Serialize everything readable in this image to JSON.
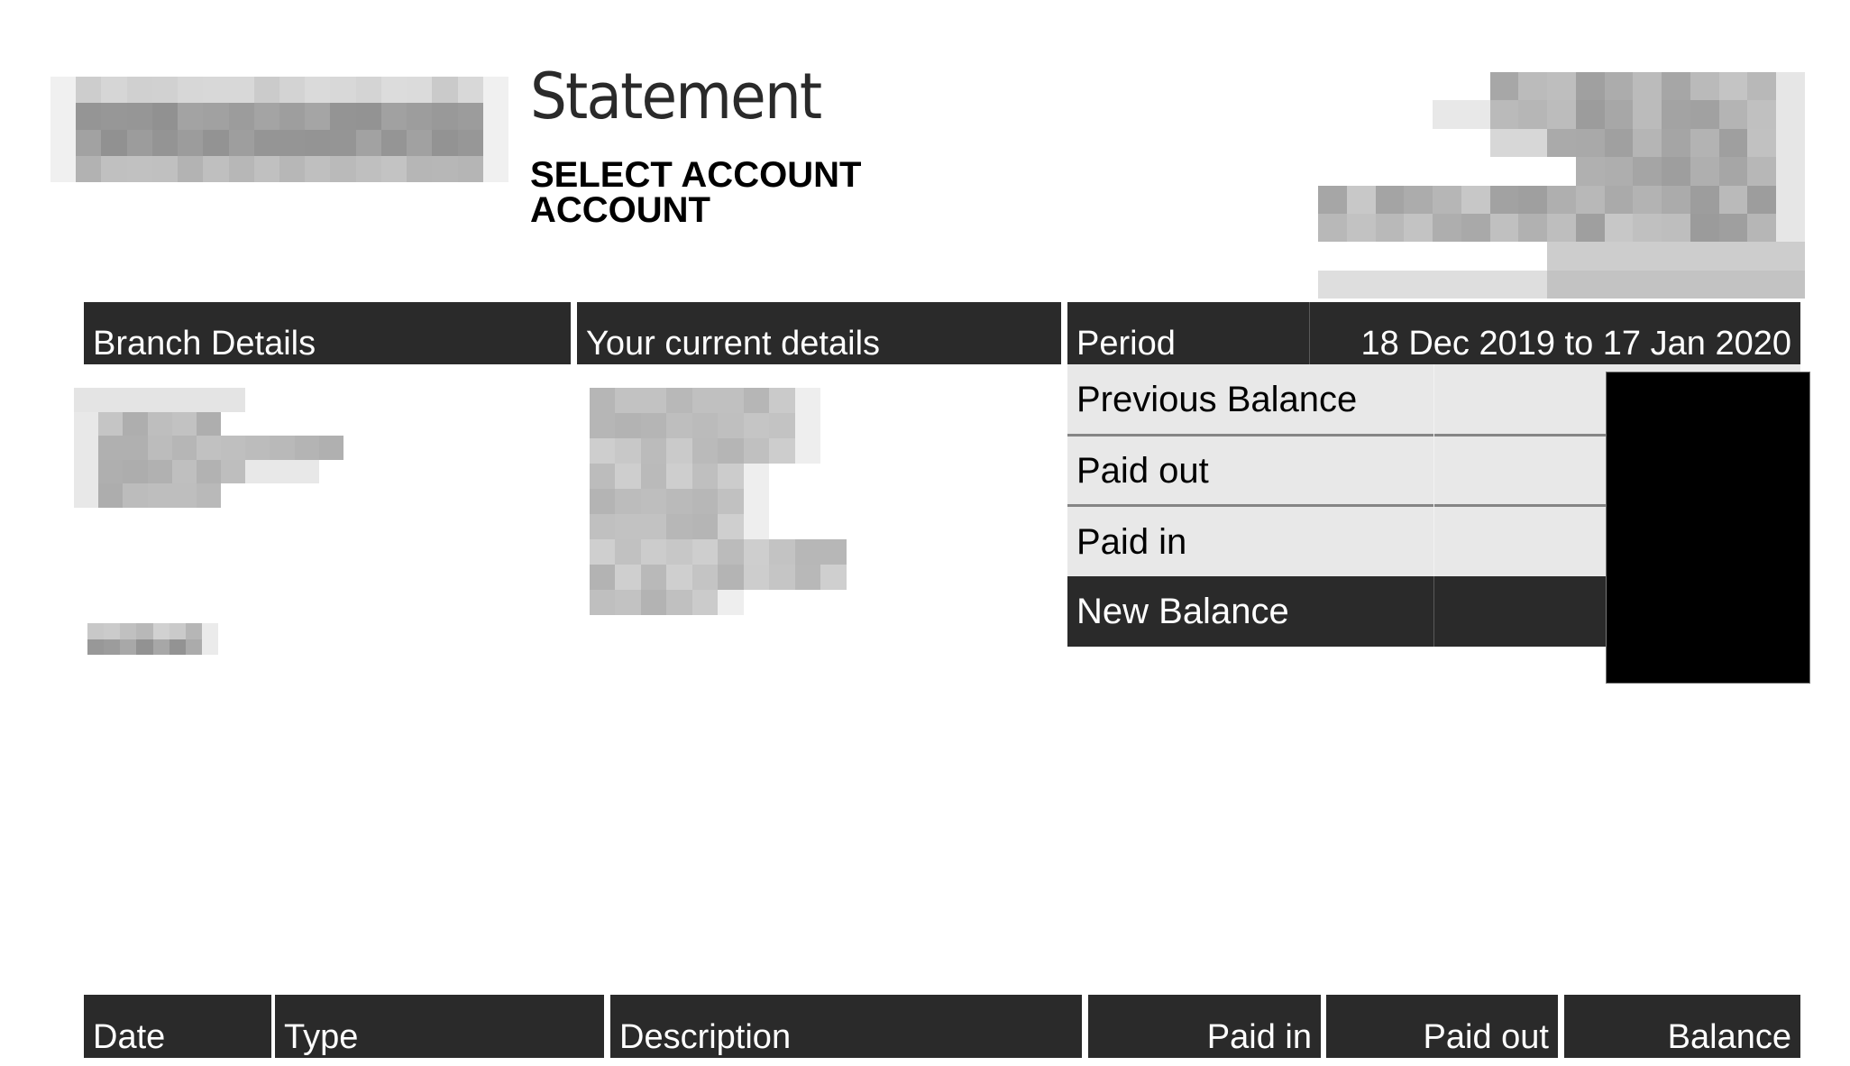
{
  "document": {
    "title": "Statement",
    "account_line_1": "SELECT ACCOUNT",
    "account_line_2": "ACCOUNT"
  },
  "details_header": {
    "branch_details": "Branch Details",
    "your_current_details": "Your current details",
    "period_label": "Period",
    "period_value": "18 Dec 2019 to 17 Jan 2020"
  },
  "summary": {
    "rows": [
      {
        "label": "Previous Balance"
      },
      {
        "label": "Paid out"
      },
      {
        "label": "Paid in"
      },
      {
        "label": "New Balance"
      }
    ]
  },
  "transactions": {
    "columns": [
      "Date",
      "Type",
      "Description",
      "Paid in",
      "Paid out",
      "Balance"
    ]
  },
  "redactions": {
    "logo": "redacted-logo",
    "bank_address": "redacted-bank-address",
    "branch_details": "redacted-branch-details",
    "sort_code": "redacted-sort-code",
    "customer_address": "redacted-customer-address",
    "summary_amounts": "redacted-amounts"
  },
  "colors": {
    "header_bg": "#2a2a2a",
    "summary_bg": "#e8e8e8",
    "separator": "#858585",
    "redaction": "#000000"
  }
}
